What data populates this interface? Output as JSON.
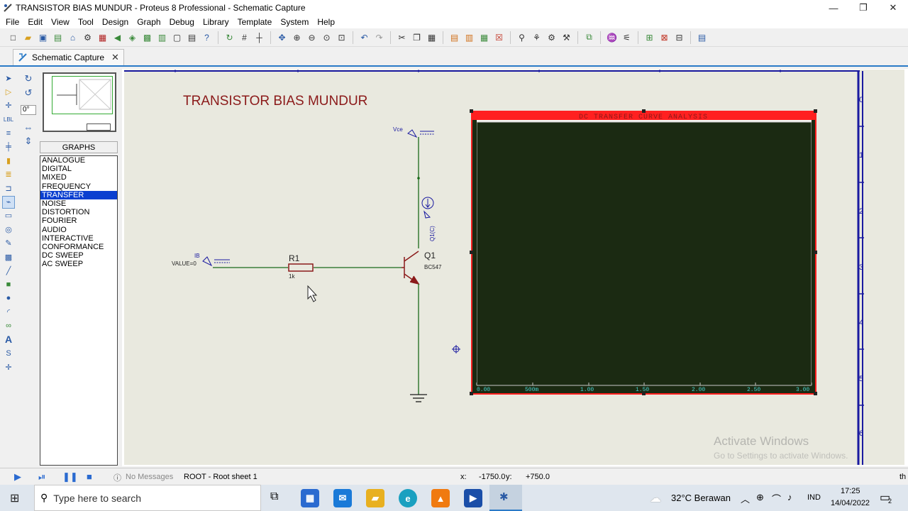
{
  "window": {
    "title": "TRANSISTOR BIAS MUNDUR - Proteus 8 Professional - Schematic Capture",
    "minimize": "—",
    "restore": "❐",
    "close": "✕"
  },
  "menu": [
    "File",
    "Edit",
    "View",
    "Tool",
    "Design",
    "Graph",
    "Debug",
    "Library",
    "Template",
    "System",
    "Help"
  ],
  "tab": {
    "label": "Schematic Capture",
    "close": "✕"
  },
  "rotation_value": "0°",
  "graphs": {
    "header": "GRAPHS",
    "items": [
      "ANALOGUE",
      "DIGITAL",
      "MIXED",
      "FREQUENCY",
      "TRANSFER",
      "NOISE",
      "DISTORTION",
      "FOURIER",
      "AUDIO",
      "INTERACTIVE",
      "CONFORMANCE",
      "DC SWEEP",
      "AC SWEEP"
    ],
    "selected": "TRANSFER"
  },
  "schematic": {
    "title": "TRANSISTOR BIAS MUNDUR",
    "vce_label": "Vce",
    "ib_label": "IB",
    "ib_value": "VALUE=0",
    "r1_name": "R1",
    "r1_value": "1k",
    "q1_name": "Q1",
    "q1_model": "BC547",
    "probe_label": "Q1(C)"
  },
  "graph": {
    "title": "DC TRANSFER CURVE ANALYSIS",
    "x_ticks": [
      "0.00",
      "500m",
      "1.00",
      "1.50",
      "2.00",
      "2.50",
      "3.00"
    ]
  },
  "ruler": [
    "0",
    "1",
    "2",
    "3",
    "4",
    "5",
    "6"
  ],
  "watermark": {
    "line1": "Activate Windows",
    "line2": "Go to Settings to activate Windows."
  },
  "status": {
    "messages": "No Messages",
    "sheet": "ROOT - Root sheet 1",
    "x_label": "x:",
    "x_value": "-1750.0",
    "y_label": "y:",
    "y_value": "+750.0",
    "edge": "th"
  },
  "taskbar": {
    "search_placeholder": "Type here to search",
    "weather": "32°C  Berawan",
    "lang": "IND",
    "time": "17:25",
    "date": "14/04/2022",
    "notif": "2"
  },
  "colors": {
    "accent": "#2a7ac7",
    "graph_border": "#ff2020",
    "graph_bg": "#1b2a12",
    "wire": "#1a6a1a",
    "component": "#8b1a1a",
    "label_blue": "#1a1aa0",
    "ruler": "#1a1aa0"
  }
}
